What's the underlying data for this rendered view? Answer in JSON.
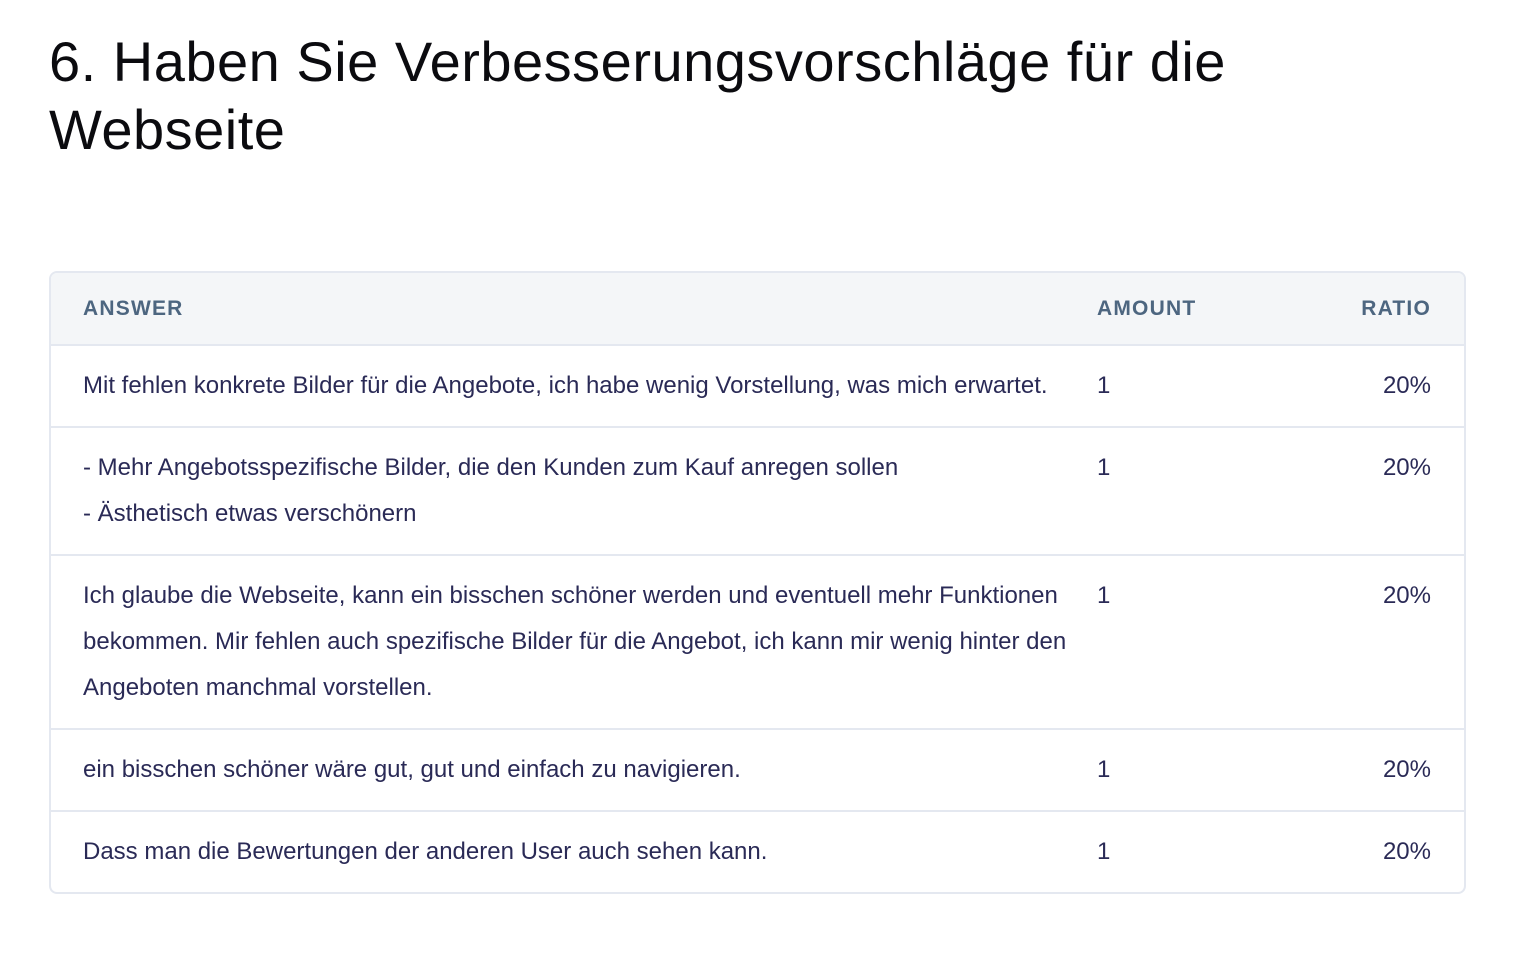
{
  "question": {
    "title": "6. Haben Sie Verbesserungsvorschläge für die Webseite"
  },
  "table": {
    "headers": {
      "answer": "ANSWER",
      "amount": "AMOUNT",
      "ratio": "RATIO"
    },
    "rows": [
      {
        "answer": "Mit fehlen konkrete Bilder für die Angebote, ich habe wenig Vorstellung, was mich erwartet.",
        "amount": "1",
        "ratio": "20%"
      },
      {
        "answer": "- Mehr Angebotsspezifische Bilder, die den Kunden zum Kauf anregen sollen\n- Ästhetisch etwas verschönern",
        "amount": "1",
        "ratio": "20%"
      },
      {
        "answer": "Ich glaube die Webseite, kann ein bisschen schöner werden und eventuell mehr Funktionen bekommen. Mir fehlen auch spezifische Bilder für die Angebot, ich kann mir wenig hinter den Angeboten manchmal vorstellen.",
        "amount": "1",
        "ratio": "20%"
      },
      {
        "answer": "ein bisschen schöner wäre gut, gut und einfach zu navigieren.",
        "amount": "1",
        "ratio": "20%"
      },
      {
        "answer": "Dass man die Bewertungen der anderen User auch sehen kann.",
        "amount": "1",
        "ratio": "20%"
      }
    ]
  },
  "colors": {
    "title": "#0b0b0f",
    "body_text": "#2a2a56",
    "header_text": "#4d6680",
    "header_background": "#f4f6f8",
    "border": "#e4e8f0"
  }
}
